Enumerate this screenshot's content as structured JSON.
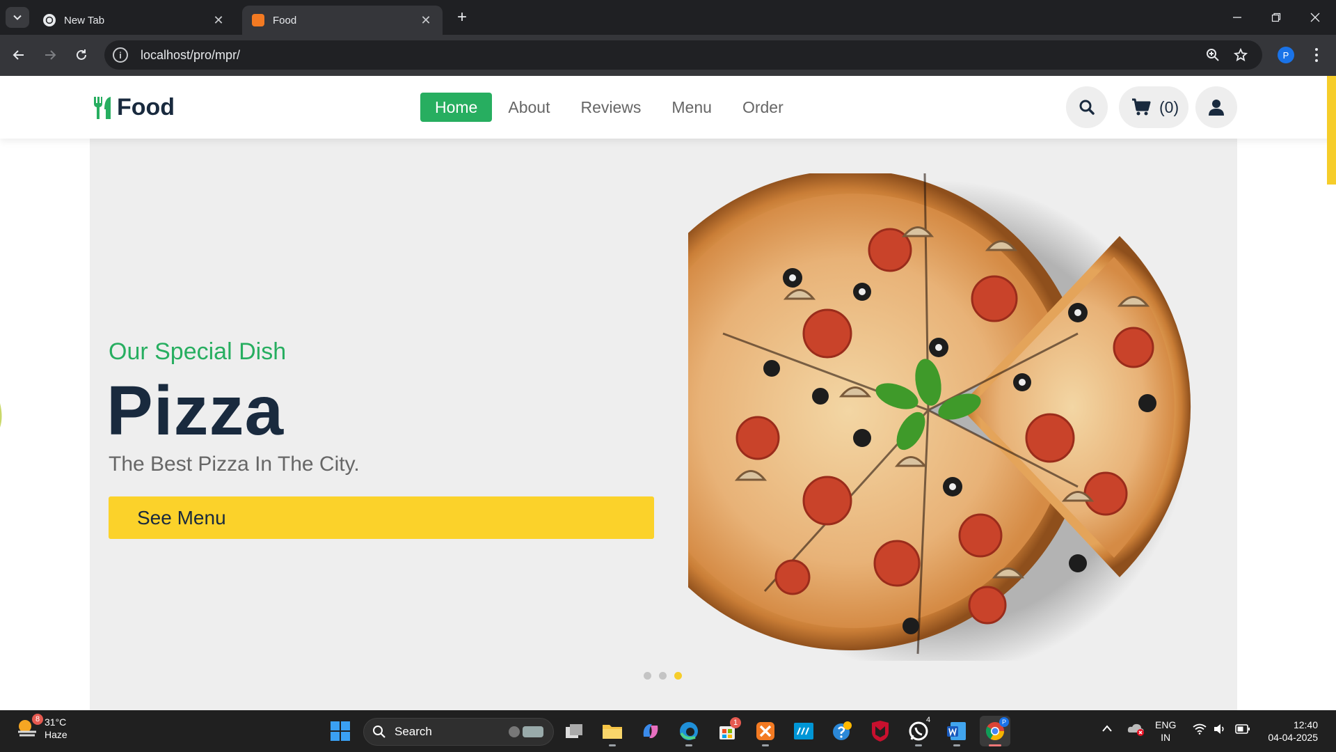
{
  "browser": {
    "tabs": [
      {
        "title": "New Tab",
        "active": false
      },
      {
        "title": "Food",
        "active": true
      }
    ],
    "url": "localhost/pro/mpr/",
    "profile_initial": "P"
  },
  "site": {
    "logo_text": "Food",
    "nav": [
      "Home",
      "About",
      "Reviews",
      "Menu",
      "Order"
    ],
    "active_nav": "Home",
    "cart_count": "(0)",
    "hero": {
      "subtitle": "Our Special Dish",
      "title": "Pizza",
      "tagline": "The Best Pizza In The City.",
      "cta": "See Menu"
    },
    "slider_dots": 3,
    "active_dot": 3
  },
  "taskbar": {
    "weather_temp": "31°C",
    "weather_desc": "Haze",
    "weather_badge": "8",
    "search_label": "Search",
    "store_badge": "1",
    "whatsapp_badge": "4",
    "lang_top": "ENG",
    "lang_bottom": "IN",
    "time": "12:40",
    "date": "04-04-2025"
  },
  "colors": {
    "green": "#27ae60",
    "yellow": "#fbd22a",
    "dark": "#192a3e",
    "hero_bg": "#eeeeee"
  }
}
